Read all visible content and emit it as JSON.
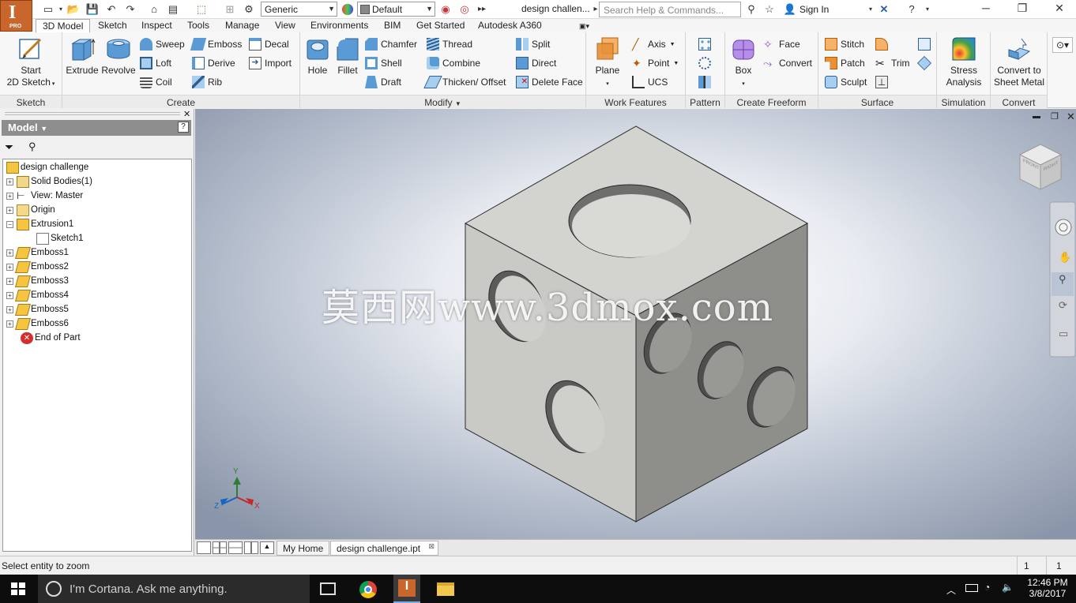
{
  "app": {
    "logo_letter": "I",
    "logo_sub": "PRO",
    "material": "Generic",
    "appearance": "Default",
    "document_title": "design challen...",
    "search_placeholder": "Search Help & Commands...",
    "sign_in": "Sign In"
  },
  "tabs": [
    "3D Model",
    "Sketch",
    "Inspect",
    "Tools",
    "Manage",
    "View",
    "Environments",
    "BIM",
    "Get Started",
    "Autodesk A360"
  ],
  "ribbon": {
    "sketch": {
      "label": "Sketch",
      "start_line1": "Start",
      "start_line2": "2D Sketch"
    },
    "create": {
      "label": "Create",
      "extrude": "Extrude",
      "revolve": "Revolve",
      "sweep": "Sweep",
      "loft": "Loft",
      "coil": "Coil",
      "emboss": "Emboss",
      "derive": "Derive",
      "rib": "Rib",
      "decal": "Decal",
      "import": "Import"
    },
    "modify": {
      "label": "Modify",
      "hole": "Hole",
      "fillet": "Fillet",
      "chamfer": "Chamfer",
      "shell": "Shell",
      "draft": "Draft",
      "thread": "Thread",
      "combine": "Combine",
      "thicken": "Thicken/ Offset",
      "split": "Split",
      "direct": "Direct",
      "delete_face": "Delete Face"
    },
    "work_features": {
      "label": "Work Features",
      "plane": "Plane",
      "axis": "Axis",
      "point": "Point",
      "ucs": "UCS"
    },
    "pattern": {
      "label": "Pattern"
    },
    "freeform": {
      "label": "Create Freeform",
      "box": "Box",
      "face": "Face",
      "convert": "Convert"
    },
    "surface": {
      "label": "Surface",
      "stitch": "Stitch",
      "patch": "Patch",
      "sculpt": "Sculpt",
      "trim": "Trim"
    },
    "simulation": {
      "label": "Simulation",
      "stress_line1": "Stress",
      "stress_line2": "Analysis"
    },
    "convert": {
      "label": "Convert",
      "line1": "Convert to",
      "line2": "Sheet Metal"
    }
  },
  "browser": {
    "title": "Model",
    "nodes": [
      {
        "label": "design challenge"
      },
      {
        "label": "Solid Bodies(1)"
      },
      {
        "label": "View: Master"
      },
      {
        "label": "Origin"
      },
      {
        "label": "Extrusion1"
      },
      {
        "label": "Sketch1"
      },
      {
        "label": "Emboss1"
      },
      {
        "label": "Emboss2"
      },
      {
        "label": "Emboss3"
      },
      {
        "label": "Emboss4"
      },
      {
        "label": "Emboss5"
      },
      {
        "label": "Emboss6"
      },
      {
        "label": "End of Part"
      }
    ]
  },
  "viewport": {
    "watermark": "莫西网www.3dmox.com",
    "viewcube_front": "FRONT",
    "viewcube_right": "RIGHT",
    "axis_x": "X",
    "axis_y": "Y",
    "axis_z": "Z"
  },
  "doc_tabs": {
    "home": "My Home",
    "active": "design challenge.ipt"
  },
  "status": {
    "message": "Select entity to zoom",
    "count1": "1",
    "count2": "1"
  },
  "taskbar": {
    "cortana": "I'm Cortana. Ask me anything.",
    "time": "12:46 PM",
    "date": "3/8/2017"
  },
  "colors": {
    "accent": "#c8662c",
    "model_grey": "#9a9a9a",
    "taskbar": "#0d0d0d"
  }
}
